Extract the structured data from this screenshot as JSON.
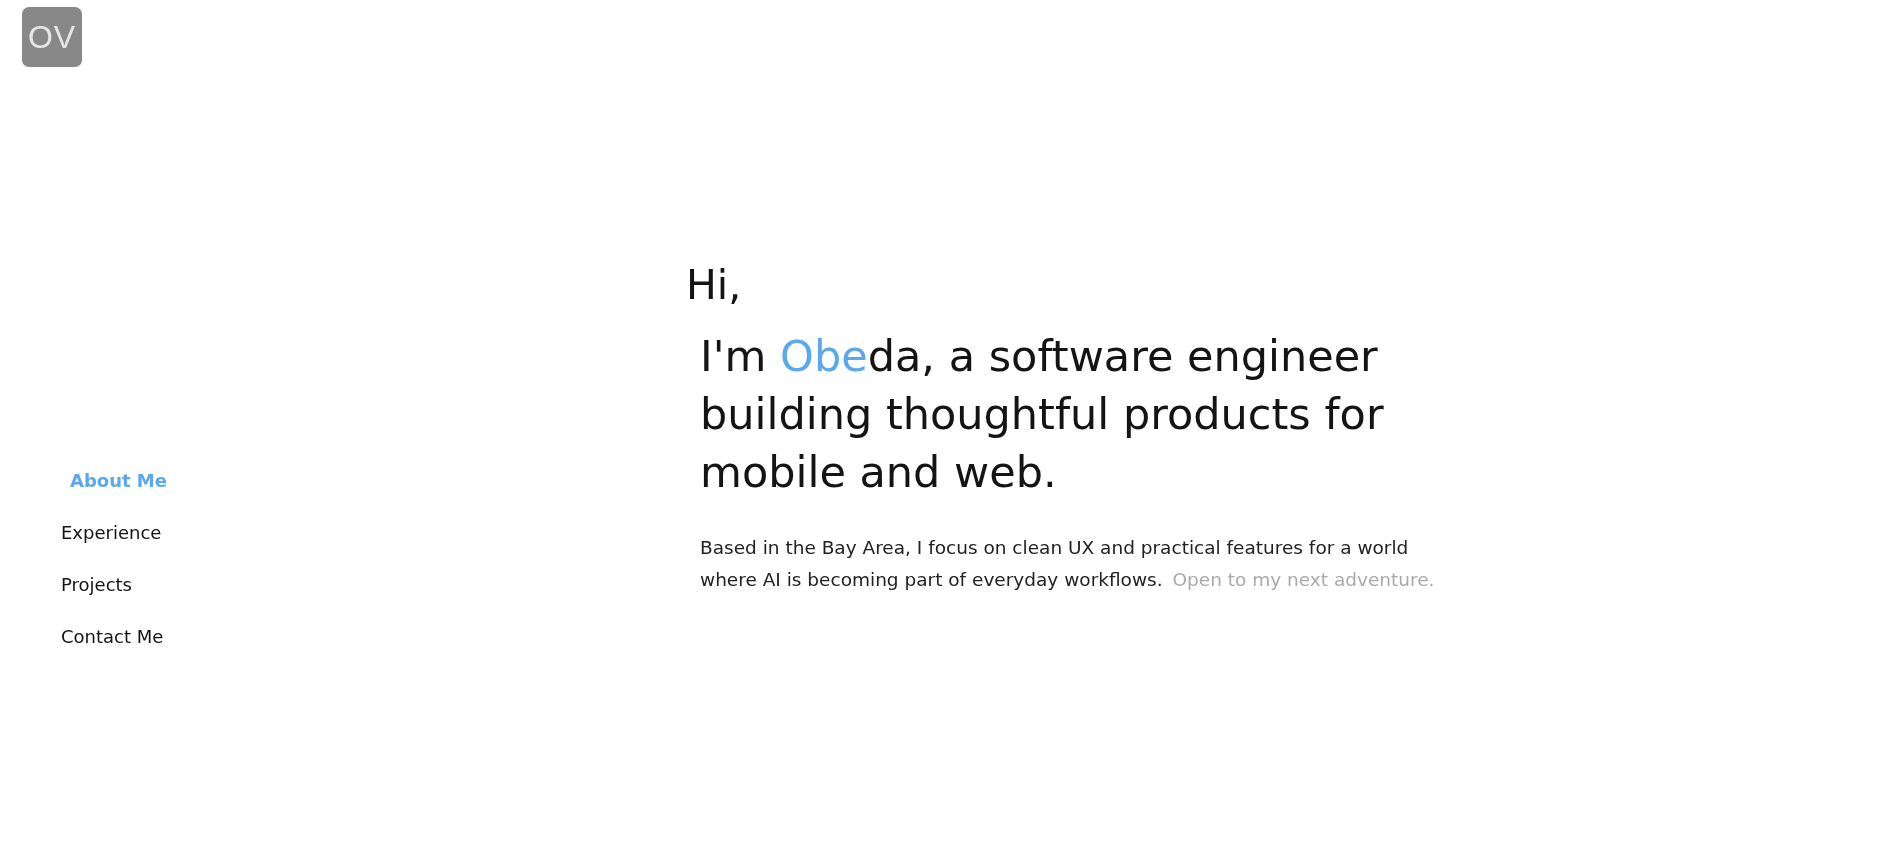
{
  "logo": {
    "text": "OV"
  },
  "nav": [
    {
      "label": "About Me",
      "selected": true
    },
    {
      "label": "Experience",
      "selected": false
    },
    {
      "label": "Projects",
      "selected": false
    },
    {
      "label": "Contact Me",
      "selected": false
    }
  ],
  "hero": {
    "greeting": "Hi,",
    "headline": [
      {
        "text": "I'm ",
        "highlight": false
      },
      {
        "text": "Obe",
        "highlight": true
      },
      {
        "text": "da, a software engineer building thoughtful products for mobile and web.",
        "highlight": false
      }
    ],
    "bio": "Based in the Bay Area, I focus on clean UX and practical features for a world where AI is becoming part of everyday workflows.",
    "status": "Open to my next adventure."
  }
}
